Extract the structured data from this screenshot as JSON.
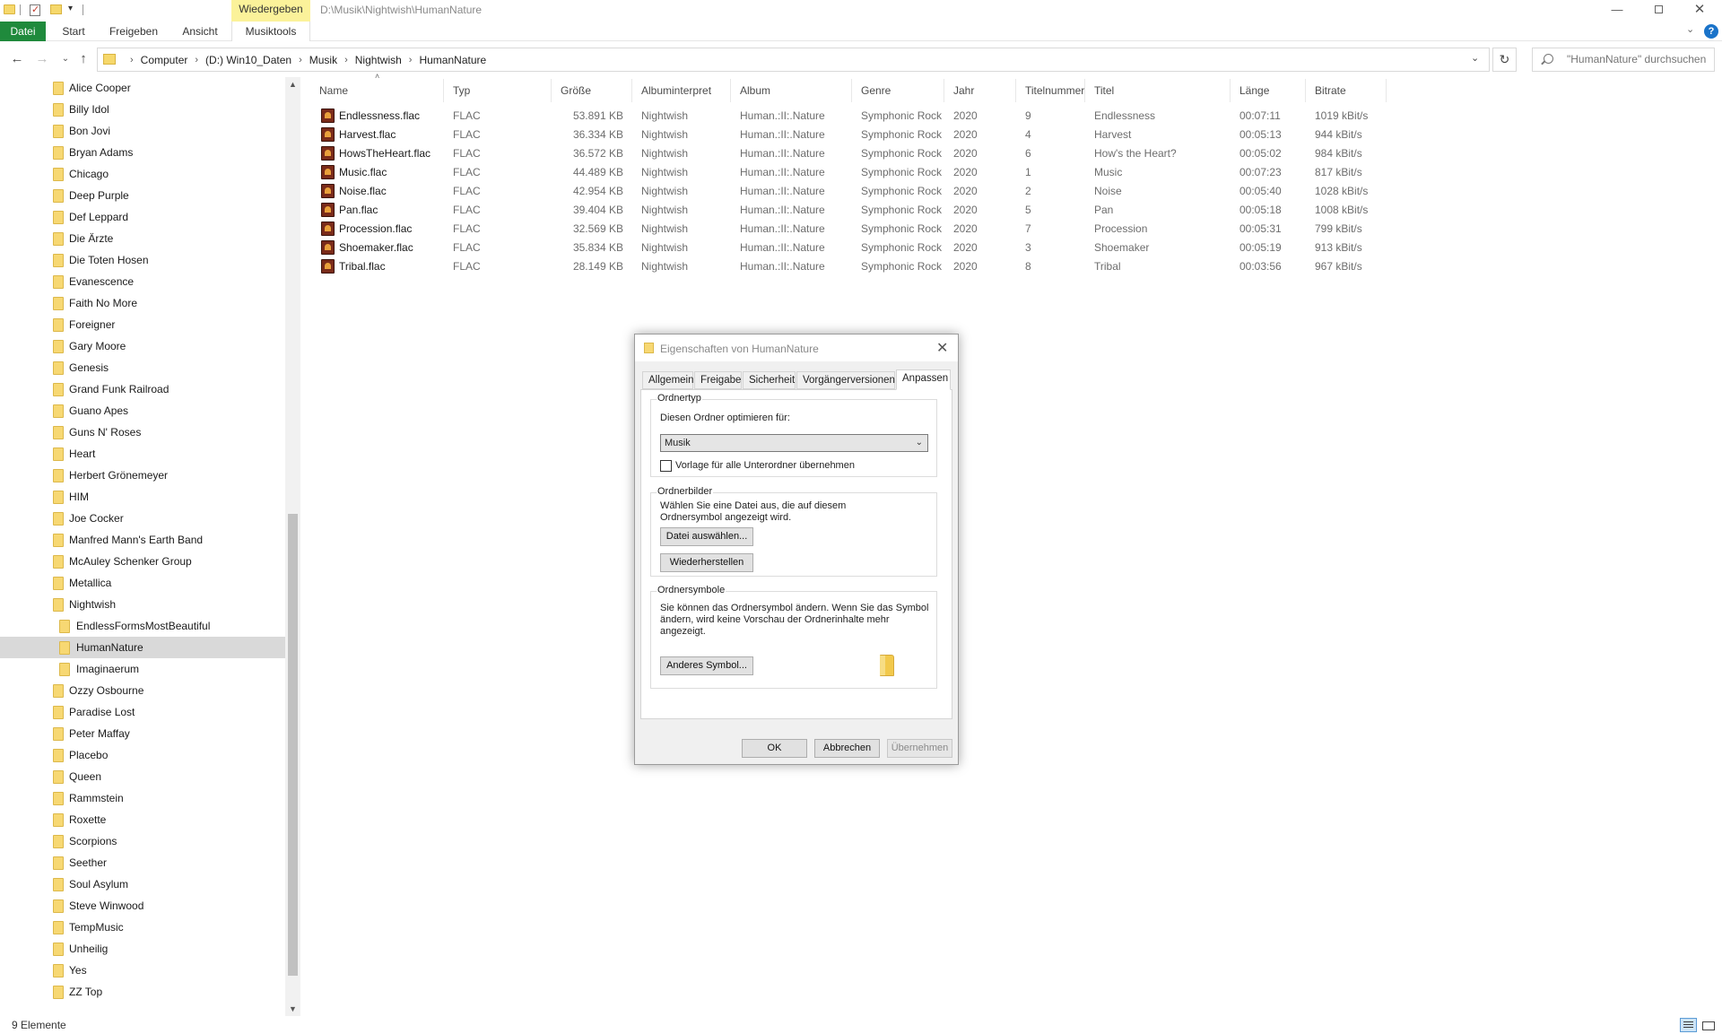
{
  "titlebar": {
    "context_tab": "Wiedergeben",
    "path": "D:\\Musik\\Nightwish\\HumanNature"
  },
  "ribbon": {
    "tabs": [
      "Datei",
      "Start",
      "Freigeben",
      "Ansicht",
      "Musiktools"
    ],
    "active_color": "#1f8a3c",
    "context_color": "#fbf29a"
  },
  "address": {
    "crumbs": [
      "Computer",
      "(D:) Win10_Daten",
      "Musik",
      "Nightwish",
      "HumanNature"
    ],
    "search_placeholder": "\"HumanNature\" durchsuchen"
  },
  "tree": [
    {
      "label": "Alice Cooper",
      "level": 0
    },
    {
      "label": "Billy Idol",
      "level": 0
    },
    {
      "label": "Bon Jovi",
      "level": 0
    },
    {
      "label": "Bryan Adams",
      "level": 0
    },
    {
      "label": "Chicago",
      "level": 0
    },
    {
      "label": "Deep Purple",
      "level": 0
    },
    {
      "label": "Def Leppard",
      "level": 0
    },
    {
      "label": "Die Ärzte",
      "level": 0
    },
    {
      "label": "Die Toten Hosen",
      "level": 0
    },
    {
      "label": "Evanescence",
      "level": 0
    },
    {
      "label": "Faith No More",
      "level": 0
    },
    {
      "label": "Foreigner",
      "level": 0
    },
    {
      "label": "Gary Moore",
      "level": 0
    },
    {
      "label": "Genesis",
      "level": 0
    },
    {
      "label": "Grand Funk Railroad",
      "level": 0
    },
    {
      "label": "Guano Apes",
      "level": 0
    },
    {
      "label": "Guns N' Roses",
      "level": 0
    },
    {
      "label": "Heart",
      "level": 0
    },
    {
      "label": "Herbert Grönemeyer",
      "level": 0
    },
    {
      "label": "HIM",
      "level": 0
    },
    {
      "label": "Joe Cocker",
      "level": 0
    },
    {
      "label": "Manfred Mann's Earth Band",
      "level": 0
    },
    {
      "label": "McAuley Schenker Group",
      "level": 0
    },
    {
      "label": "Metallica",
      "level": 0
    },
    {
      "label": "Nightwish",
      "level": 0
    },
    {
      "label": "EndlessFormsMostBeautiful",
      "level": 1
    },
    {
      "label": "HumanNature",
      "level": 1,
      "selected": true
    },
    {
      "label": "Imaginaerum",
      "level": 1
    },
    {
      "label": "Ozzy Osbourne",
      "level": 0
    },
    {
      "label": "Paradise Lost",
      "level": 0
    },
    {
      "label": "Peter Maffay",
      "level": 0
    },
    {
      "label": "Placebo",
      "level": 0
    },
    {
      "label": "Queen",
      "level": 0
    },
    {
      "label": "Rammstein",
      "level": 0
    },
    {
      "label": "Roxette",
      "level": 0
    },
    {
      "label": "Scorpions",
      "level": 0
    },
    {
      "label": "Seether",
      "level": 0
    },
    {
      "label": "Soul Asylum",
      "level": 0
    },
    {
      "label": "Steve Winwood",
      "level": 0
    },
    {
      "label": "TempMusic",
      "level": 0
    },
    {
      "label": "Unheilig",
      "level": 0
    },
    {
      "label": "Yes",
      "level": 0
    },
    {
      "label": "ZZ Top",
      "level": 0
    }
  ],
  "columns": [
    "Name",
    "Typ",
    "Größe",
    "Albuminterpret",
    "Album",
    "Genre",
    "Jahr",
    "Titelnummer",
    "Titel",
    "Länge",
    "Bitrate"
  ],
  "files": [
    [
      "Endlessness.flac",
      "FLAC",
      "53.891 KB",
      "Nightwish",
      "Human.:II:.Nature",
      "Symphonic Rock",
      "2020",
      "9",
      "Endlessness",
      "00:07:11",
      "1019 kBit/s"
    ],
    [
      "Harvest.flac",
      "FLAC",
      "36.334 KB",
      "Nightwish",
      "Human.:II:.Nature",
      "Symphonic Rock",
      "2020",
      "4",
      "Harvest",
      "00:05:13",
      "944 kBit/s"
    ],
    [
      "HowsTheHeart.flac",
      "FLAC",
      "36.572 KB",
      "Nightwish",
      "Human.:II:.Nature",
      "Symphonic Rock",
      "2020",
      "6",
      "How's the Heart?",
      "00:05:02",
      "984 kBit/s"
    ],
    [
      "Music.flac",
      "FLAC",
      "44.489 KB",
      "Nightwish",
      "Human.:II:.Nature",
      "Symphonic Rock",
      "2020",
      "1",
      "Music",
      "00:07:23",
      "817 kBit/s"
    ],
    [
      "Noise.flac",
      "FLAC",
      "42.954 KB",
      "Nightwish",
      "Human.:II:.Nature",
      "Symphonic Rock",
      "2020",
      "2",
      "Noise",
      "00:05:40",
      "1028 kBit/s"
    ],
    [
      "Pan.flac",
      "FLAC",
      "39.404 KB",
      "Nightwish",
      "Human.:II:.Nature",
      "Symphonic Rock",
      "2020",
      "5",
      "Pan",
      "00:05:18",
      "1008 kBit/s"
    ],
    [
      "Procession.flac",
      "FLAC",
      "32.569 KB",
      "Nightwish",
      "Human.:II:.Nature",
      "Symphonic Rock",
      "2020",
      "7",
      "Procession",
      "00:05:31",
      "799 kBit/s"
    ],
    [
      "Shoemaker.flac",
      "FLAC",
      "35.834 KB",
      "Nightwish",
      "Human.:II:.Nature",
      "Symphonic Rock",
      "2020",
      "3",
      "Shoemaker",
      "00:05:19",
      "913 kBit/s"
    ],
    [
      "Tribal.flac",
      "FLAC",
      "28.149 KB",
      "Nightwish",
      "Human.:II:.Nature",
      "Symphonic Rock",
      "2020",
      "8",
      "Tribal",
      "00:03:56",
      "967 kBit/s"
    ]
  ],
  "dialog": {
    "title": "Eigenschaften von HumanNature",
    "tabs": [
      "Allgemein",
      "Freigabe",
      "Sicherheit",
      "Vorgängerversionen",
      "Anpassen"
    ],
    "active_tab": "Anpassen",
    "ordnertyp": {
      "label": "Ordnertyp",
      "optimize_label": "Diesen Ordner optimieren für:",
      "selected": "Musik",
      "checkbox_label": "Vorlage für alle Unterordner übernehmen"
    },
    "ordnerbilder": {
      "label": "Ordnerbilder",
      "description": "Wählen Sie eine Datei aus, die auf diesem Ordnersymbol angezeigt wird.",
      "choose_button": "Datei auswählen...",
      "restore_button": "Wiederherstellen"
    },
    "ordnersymbole": {
      "label": "Ordnersymbole",
      "description": "Sie können das Ordnersymbol ändern. Wenn Sie das Symbol ändern, wird keine Vorschau der Ordnerinhalte mehr angezeigt.",
      "change_button": "Anderes Symbol..."
    },
    "ok": "OK",
    "cancel": "Abbrechen",
    "apply": "Übernehmen"
  },
  "status": {
    "count": "9 Elemente"
  }
}
